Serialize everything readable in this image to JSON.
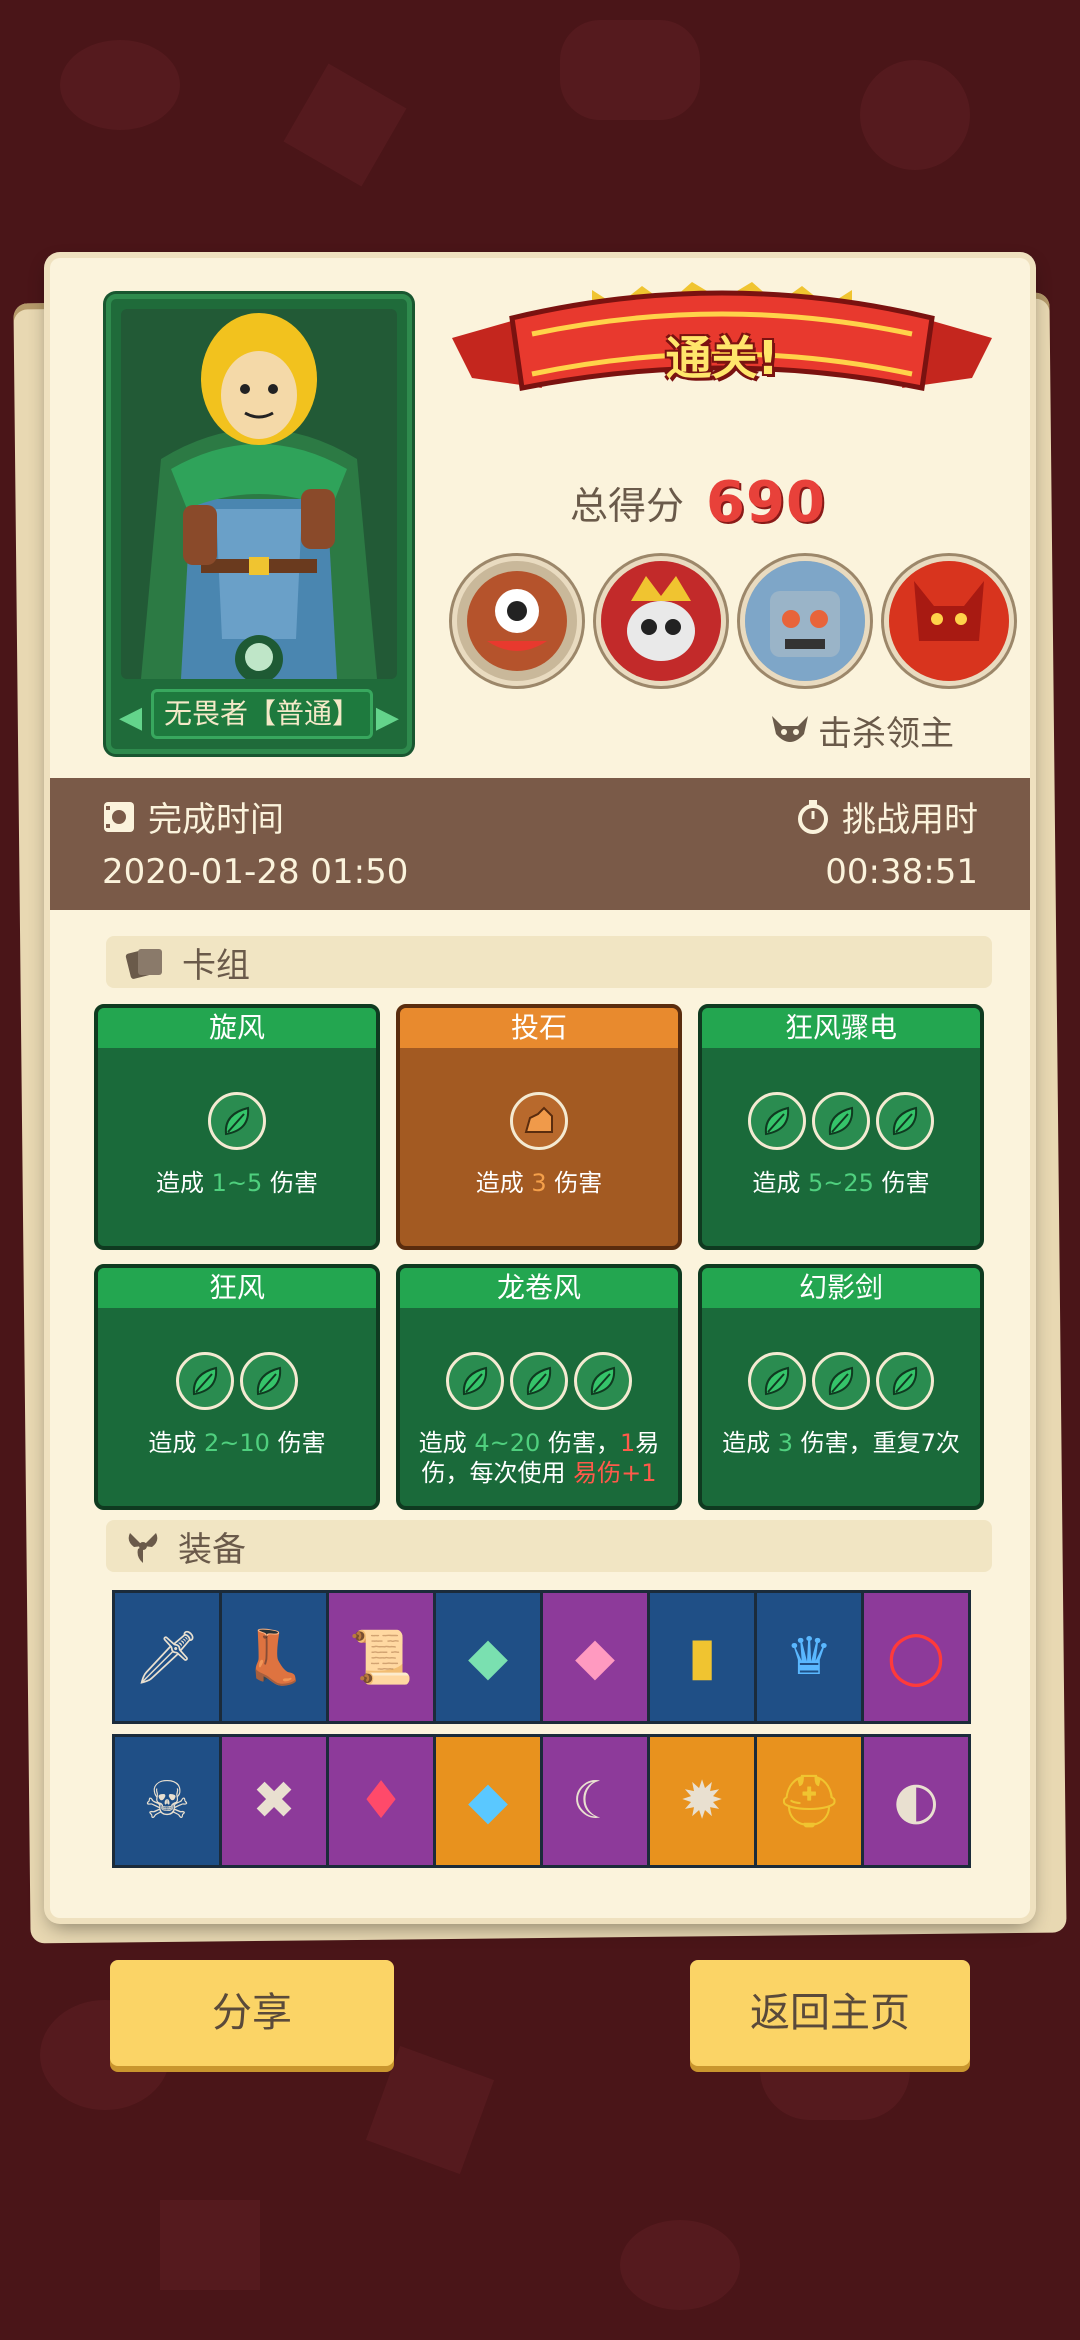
{
  "hero": {
    "name": "无畏者【普通】"
  },
  "banner": {
    "text": "通关!"
  },
  "score": {
    "label": "总得分",
    "value": "690"
  },
  "bosses_label": "击杀领主",
  "timebar": {
    "finish_label": "完成时间",
    "finish_value": "2020-01-28 01:50",
    "duration_label": "挑战用时",
    "duration_value": "00:38:51"
  },
  "deck": {
    "header": "卡组",
    "cards": [
      {
        "title": "旋风",
        "color": "green",
        "icons": 1,
        "desc": [
          "造成 ",
          "1~5",
          " 伤害"
        ]
      },
      {
        "title": "投石",
        "color": "orange",
        "icons": 1,
        "desc": [
          "造成 ",
          "3",
          " 伤害"
        ]
      },
      {
        "title": "狂风骤电",
        "color": "green",
        "icons": 3,
        "desc": [
          "造成 ",
          "5~25",
          " 伤害"
        ]
      },
      {
        "title": "狂风",
        "color": "green",
        "icons": 2,
        "desc": [
          "造成 ",
          "2~10",
          " 伤害"
        ]
      },
      {
        "title": "龙卷风",
        "color": "green",
        "icons": 3,
        "desc": [
          "造成 ",
          "4~20",
          " 伤害，",
          "1",
          "易伤，每次使用 ",
          "易伤+1"
        ]
      },
      {
        "title": "幻影剑",
        "color": "green",
        "icons": 3,
        "desc": [
          "造成 ",
          "3",
          " 伤害，重复7次"
        ]
      }
    ]
  },
  "equipment": {
    "header": "装备",
    "row1": [
      "dagger-icon",
      "boot-icon",
      "scroll-icon",
      "gem-green-icon",
      "gem-pink-icon",
      "talisman-icon",
      "crown-icon",
      "ring-icon"
    ],
    "row2": [
      "skull-icon",
      "dark-rune-icon",
      "amulet-icon",
      "crystal-icon",
      "scythe-icon",
      "spike-orb-icon",
      "helmet-icon",
      "plague-mask-icon"
    ],
    "row1_colors": [
      "blue",
      "blue",
      "purple",
      "blue",
      "purple",
      "blue",
      "blue",
      "purple"
    ],
    "row2_colors": [
      "blue",
      "purple",
      "purple",
      "orange",
      "purple",
      "orange",
      "orange",
      "purple"
    ]
  },
  "buttons": {
    "share": "分享",
    "home": "返回主页"
  },
  "colors": {
    "accent": "#e8413a",
    "card_green": "#1a6a3a",
    "card_orange": "#a35a22",
    "button": "#fbd466"
  }
}
